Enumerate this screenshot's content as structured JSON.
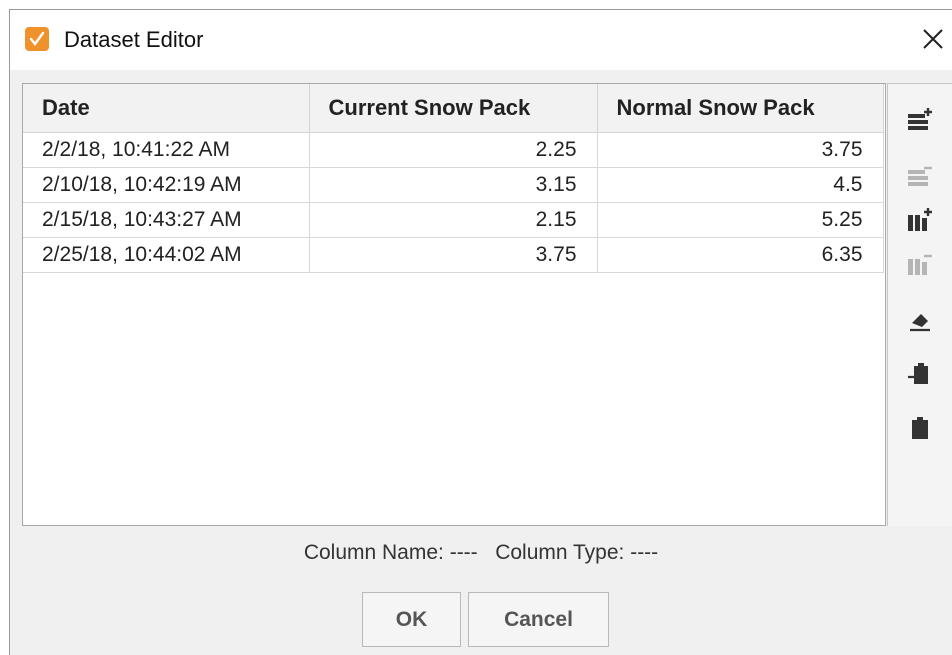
{
  "window": {
    "title": "Dataset Editor",
    "app_icon": "check-pencil-icon",
    "accent": "#f0922c"
  },
  "table": {
    "columns": [
      "Date",
      "Current Snow Pack",
      "Normal Snow Pack"
    ],
    "rows": [
      [
        "2/2/18, 10:41:22 AM",
        "2.25",
        "3.75"
      ],
      [
        "2/10/18, 10:42:19 AM",
        "3.15",
        "4.5"
      ],
      [
        "2/15/18, 10:43:27 AM",
        "2.15",
        "5.25"
      ],
      [
        "2/25/18, 10:44:02 AM",
        "3.75",
        "6.35"
      ]
    ]
  },
  "toolbar": [
    {
      "name": "add-row-icon",
      "enabled": true
    },
    {
      "name": "remove-row-icon",
      "enabled": false
    },
    {
      "name": "add-column-icon",
      "enabled": true
    },
    {
      "name": "remove-column-icon",
      "enabled": false
    },
    {
      "name": "eraser-icon",
      "enabled": true
    },
    {
      "name": "paste-import-icon",
      "enabled": true
    },
    {
      "name": "clipboard-icon",
      "enabled": true
    }
  ],
  "footer": {
    "column_name_label": "Column Name: ----",
    "column_type_label": "Column Type: ----"
  },
  "buttons": {
    "ok": "OK",
    "cancel": "Cancel"
  }
}
